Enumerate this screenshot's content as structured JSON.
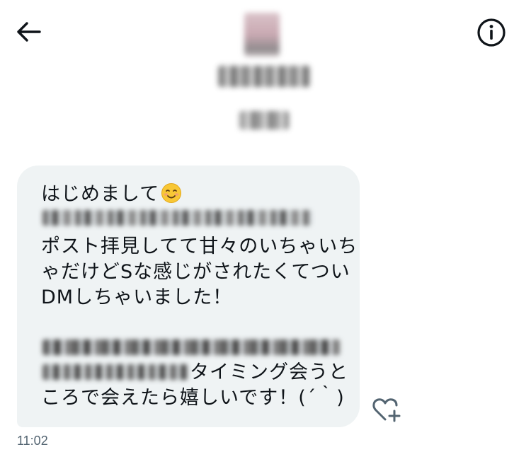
{
  "header": {
    "back_icon": "arrow-left-icon",
    "info_icon": "info-icon",
    "avatar_obscured": true,
    "name_obscured": true,
    "handle_obscured": true
  },
  "message": {
    "lines": {
      "l1": "はじめまして",
      "l3": "ポスト拝見してて甘々のいちゃいち",
      "l4": "ゃだけどSな感じがされたくてつい",
      "l5": "DMしちゃいました！",
      "l7_suffix": "タイミング会うと",
      "l8": "ころで会えたら嬉しいです！(´｀)"
    },
    "emoji_icon": "smiling-face-icon",
    "timestamp": "11:02",
    "react_icon": "heart-plus-icon"
  },
  "colors": {
    "bubble_bg": "#eff3f4",
    "text": "#0f1419",
    "secondary_text": "#536471"
  }
}
